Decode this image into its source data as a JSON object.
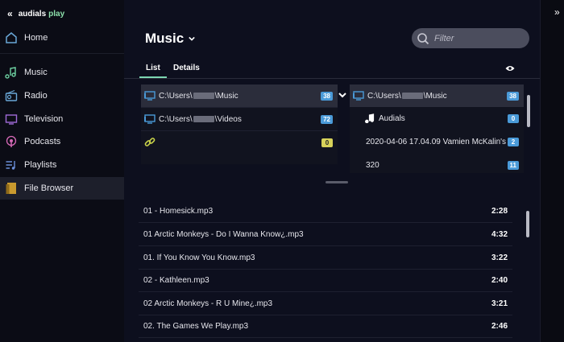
{
  "app": {
    "brand_part1": "audials",
    "brand_part2": "play"
  },
  "sidebar": {
    "items": [
      {
        "label": "Home",
        "icon": "home-icon"
      },
      {
        "label": "Music",
        "icon": "music-note-icon"
      },
      {
        "label": "Radio",
        "icon": "radio-icon"
      },
      {
        "label": "Television",
        "icon": "tv-icon"
      },
      {
        "label": "Podcasts",
        "icon": "podcast-icon"
      },
      {
        "label": "Playlists",
        "icon": "playlist-icon"
      },
      {
        "label": "File Browser",
        "icon": "file-browser-icon",
        "active": true
      }
    ]
  },
  "header": {
    "title": "Music"
  },
  "filter": {
    "placeholder": "Filter"
  },
  "tabs": [
    {
      "label": "List",
      "active": true
    },
    {
      "label": "Details"
    }
  ],
  "left_panel": {
    "rows": [
      {
        "icon": "pc-icon",
        "prefix": "C:\\Users\\",
        "suffix": "\\Music",
        "count": "38",
        "badge": "blue",
        "selected": true
      },
      {
        "icon": "pc-icon",
        "prefix": "C:\\Users\\",
        "suffix": "\\Videos",
        "count": "72",
        "badge": "blue"
      },
      {
        "icon": "link-icon",
        "prefix": "",
        "suffix": "",
        "count": "0",
        "badge": "yellow"
      }
    ]
  },
  "right_panel": {
    "rows": [
      {
        "icon": "pc-icon",
        "prefix": "C:\\Users\\",
        "suffix": "\\Music",
        "count": "38",
        "selected": true,
        "redacted": true
      },
      {
        "icon": "music-note-icon",
        "prefix": "Audials",
        "suffix": "",
        "count": "0"
      },
      {
        "icon": "",
        "prefix": "2020-04-06 17.04.09 Vamien McKalin's 2",
        "suffix": "",
        "count": "2"
      },
      {
        "icon": "",
        "prefix": "320",
        "suffix": "",
        "count": "11"
      }
    ]
  },
  "files": [
    {
      "name": "01 - Homesick.mp3",
      "duration": "2:28"
    },
    {
      "name": "01 Arctic Monkeys - Do I Wanna Know¿.mp3",
      "duration": "4:32"
    },
    {
      "name": "01. If You Know You Know.mp3",
      "duration": "3:22"
    },
    {
      "name": "02 - Kathleen.mp3",
      "duration": "2:40"
    },
    {
      "name": "02 Arctic Monkeys - R U Mine¿.mp3",
      "duration": "3:21"
    },
    {
      "name": "02. The Games We Play.mp3",
      "duration": "2:46"
    }
  ],
  "colors": {
    "accent": "#7dd6b2",
    "badge_blue": "#4a9ad8",
    "badge_yellow": "#d7d25a",
    "brand_green": "#8ce0ab"
  }
}
